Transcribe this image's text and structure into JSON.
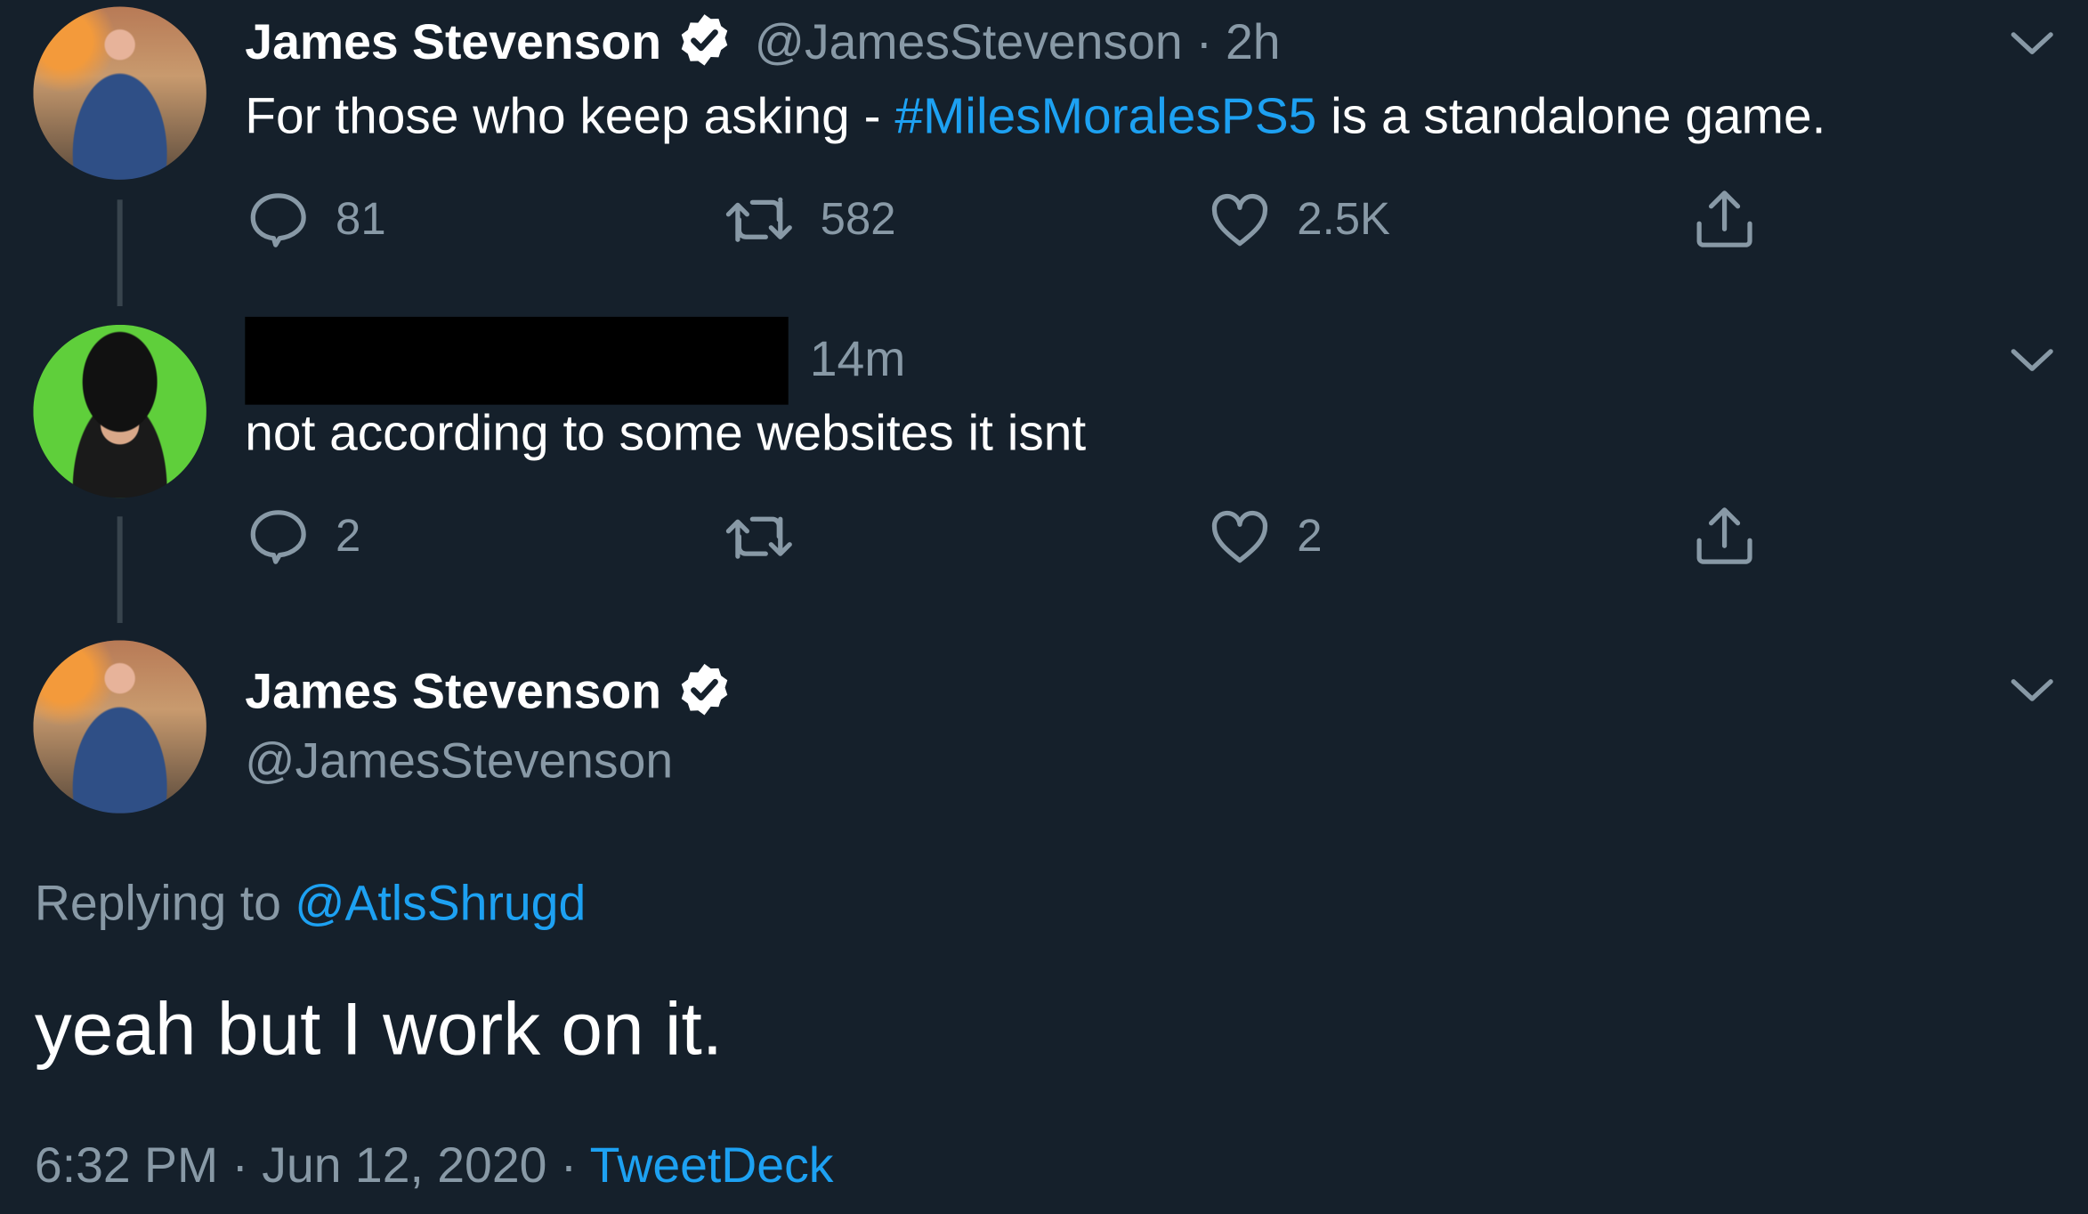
{
  "tweets": [
    {
      "name": "James Stevenson",
      "handle": "@JamesStevenson",
      "sep": "·",
      "time": "2h",
      "text_before": "For those who keep asking - ",
      "hashtag": "#MilesMoralesPS5",
      "text_after": " is a standalone game.",
      "replies": "81",
      "retweets": "582",
      "likes": "2.5K"
    },
    {
      "time": "14m",
      "text": "not according to some websites it isnt",
      "replies": "2",
      "retweets": "",
      "likes": "2"
    }
  ],
  "focused": {
    "name": "James Stevenson",
    "handle": "@JamesStevenson",
    "replying_label": "Replying to ",
    "replying_handle": "@AtlsShrugd",
    "text": "yeah but I work on it.",
    "timestamp": "6:32 PM · Jun 12, 2020 · ",
    "source": "TweetDeck"
  },
  "colors": {
    "background": "#15202b",
    "text": "#ffffff",
    "muted": "#8899a6",
    "accent": "#1da1f2",
    "thread_line": "#38444d"
  },
  "icons": [
    "verified-badge-icon",
    "reply-icon",
    "retweet-icon",
    "like-icon",
    "share-icon",
    "chevron-down-icon"
  ]
}
